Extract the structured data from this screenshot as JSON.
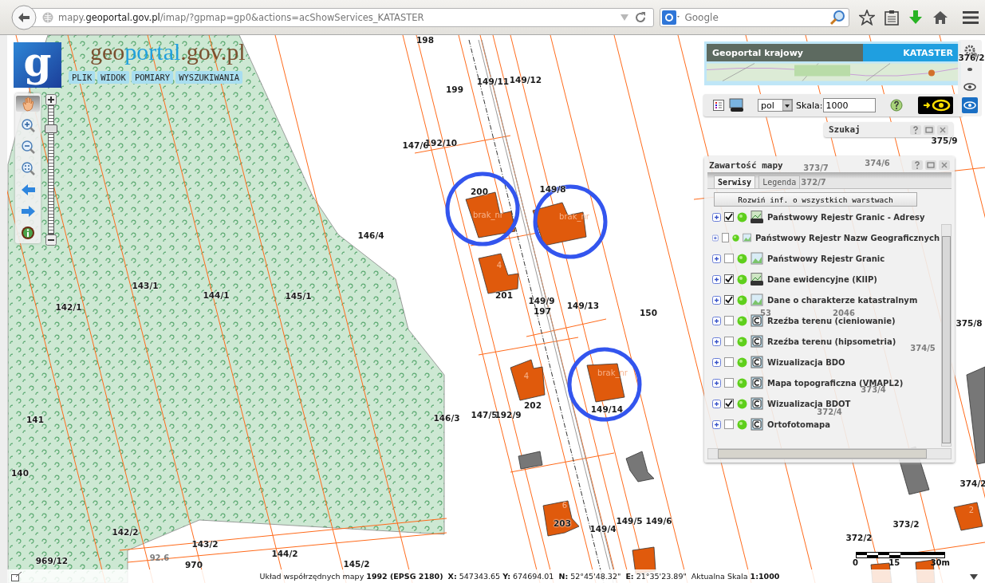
{
  "browser": {
    "url": "mapy.**geoportal.gov.pl**/imap/?gpmap=gp0&actions=acShowServices_KATASTER",
    "search_placeholder": "Google"
  },
  "header": {
    "logo_letter": "g",
    "title_parts": [
      "geo",
      "portal",
      ".gov.pl"
    ],
    "menu": [
      "PLIK",
      "WIDOK",
      "POMIARY",
      "WYSZUKIWANIA"
    ]
  },
  "nav_tools": [
    {
      "kind": "pan",
      "selected": true
    },
    {
      "kind": "zoom_in",
      "selected": false
    },
    {
      "kind": "zoom_out",
      "selected": false
    },
    {
      "kind": "zoom_extent",
      "selected": false
    },
    {
      "kind": "back",
      "selected": false
    },
    {
      "kind": "forward",
      "selected": false
    },
    {
      "kind": "info",
      "selected": false
    }
  ],
  "zoom_slider": {
    "level": 0.85
  },
  "banner": {
    "title": "Geoportal krajowy",
    "badge": "KATASTER"
  },
  "toolbar": {
    "language": "pol",
    "scale_label": "Skala:",
    "scale_value": "1000"
  },
  "side_tools": [
    {
      "kind": "gear",
      "selected": false
    },
    {
      "kind": "dot",
      "selected": false
    },
    {
      "kind": "eye",
      "selected": false
    },
    {
      "kind": "eye",
      "selected": true
    }
  ],
  "search_panel": {
    "title": "Szukaj"
  },
  "layers_panel": {
    "title": "Zawartość mapy",
    "tabs": [
      {
        "label": "Serwisy",
        "selected": true
      },
      {
        "label": "Legenda",
        "selected": false
      }
    ],
    "expand_all": "Rozwiń inf. o wszystkich warstwach",
    "layers": [
      {
        "name": "Państwowy Rejestr Granic - Adresy",
        "checked": true,
        "kind": "wms"
      },
      {
        "name": "Państwowy Rejestr Nazw Geograficznych",
        "checked": false,
        "kind": "image"
      },
      {
        "name": "Państwowy Rejestr Granic",
        "checked": false,
        "kind": "image"
      },
      {
        "name": "Dane ewidencyjne (KIIP)",
        "checked": true,
        "kind": "wms"
      },
      {
        "name": "Dane o charakterze katastralnym",
        "checked": true,
        "kind": "image"
      },
      {
        "name": "Rzeźba terenu (cieniowanie)",
        "checked": false,
        "kind": "cache"
      },
      {
        "name": "Rzeźba terenu (hipsometria)",
        "checked": false,
        "kind": "cache"
      },
      {
        "name": "Wizualizacja BDO",
        "checked": false,
        "kind": "cache"
      },
      {
        "name": "Mapa topograficzna (VMAPL2)",
        "checked": false,
        "kind": "cache"
      },
      {
        "name": "Wizualizacja BDOT",
        "checked": true,
        "kind": "cache"
      },
      {
        "name": "Ortofotomapa",
        "checked": false,
        "kind": "cache"
      }
    ]
  },
  "map": {
    "labels": [
      {
        "text": "198",
        "kind": "parcel"
      },
      {
        "text": "199",
        "kind": "parcel"
      },
      {
        "text": "149/11",
        "kind": "parcel"
      },
      {
        "text": "149/12",
        "kind": "parcel"
      },
      {
        "text": "147/6",
        "kind": "parcel"
      },
      {
        "text": "192/10",
        "kind": "parcel"
      },
      {
        "text": "200",
        "kind": "parcel"
      },
      {
        "text": "149/8",
        "kind": "parcel"
      },
      {
        "text": "146/4",
        "kind": "parcel"
      },
      {
        "text": "143/1",
        "kind": "parcel"
      },
      {
        "text": "144/1",
        "kind": "parcel"
      },
      {
        "text": "145/1",
        "kind": "parcel"
      },
      {
        "text": "142/1",
        "kind": "parcel"
      },
      {
        "text": "201",
        "kind": "parcel"
      },
      {
        "text": "149/9",
        "kind": "parcel"
      },
      {
        "text": "197",
        "kind": "parcel"
      },
      {
        "text": "149/13",
        "kind": "parcel"
      },
      {
        "text": "150",
        "kind": "parcel"
      },
      {
        "text": "146/3",
        "kind": "parcel"
      },
      {
        "text": "147/5",
        "kind": "parcel"
      },
      {
        "text": "192/9",
        "kind": "parcel"
      },
      {
        "text": "202",
        "kind": "parcel"
      },
      {
        "text": "149/14",
        "kind": "parcel"
      },
      {
        "text": "141",
        "kind": "parcel"
      },
      {
        "text": "140",
        "kind": "parcel"
      },
      {
        "text": "142/2",
        "kind": "parcel"
      },
      {
        "text": "143/2",
        "kind": "parcel"
      },
      {
        "text": "144/2",
        "kind": "parcel"
      },
      {
        "text": "145/2",
        "kind": "parcel"
      },
      {
        "text": "969/12",
        "kind": "parcel"
      },
      {
        "text": "970",
        "kind": "parcel"
      },
      {
        "text": "203",
        "kind": "parcel"
      },
      {
        "text": "149/4",
        "kind": "parcel"
      },
      {
        "text": "149/5",
        "kind": "parcel"
      },
      {
        "text": "149/6",
        "kind": "parcel"
      },
      {
        "text": "376/2",
        "kind": "parcel"
      },
      {
        "text": "375/9",
        "kind": "parcel"
      },
      {
        "text": "375/8",
        "kind": "parcel"
      },
      {
        "text": "374/2",
        "kind": "parcel"
      },
      {
        "text": "373/2",
        "kind": "parcel"
      },
      {
        "text": "372/2",
        "kind": "parcel"
      },
      {
        "text": "92.6",
        "kind": "faded"
      },
      {
        "text": "373/7",
        "kind": "faded"
      },
      {
        "text": "374/6",
        "kind": "faded"
      },
      {
        "text": "372/7",
        "kind": "faded"
      },
      {
        "text": "53",
        "kind": "faded"
      },
      {
        "text": "2046",
        "kind": "faded"
      },
      {
        "text": "374/5",
        "kind": "faded"
      },
      {
        "text": "373/4",
        "kind": "faded"
      },
      {
        "text": "372/4",
        "kind": "faded"
      },
      {
        "text": "brak_nr",
        "kind": "building"
      },
      {
        "text": "brak_nr",
        "kind": "building"
      },
      {
        "text": "brak_nr",
        "kind": "building"
      },
      {
        "text": "4",
        "kind": "building"
      },
      {
        "text": "4",
        "kind": "building"
      },
      {
        "text": "6",
        "kind": "building"
      },
      {
        "text": "2",
        "kind": "building"
      }
    ]
  },
  "scale_bar": {
    "labels": [
      "0",
      "15",
      "30m"
    ]
  },
  "status_bar": {
    "text": "Układ współrzędnych mapy **1992 (EPSG 2180)**  **X:** 547343.65 **Y:** 674694.01  **N:** 52°45'48.32\"  **E:** 21°35'23.89\"  Aktualna Skala **1:1000**"
  }
}
